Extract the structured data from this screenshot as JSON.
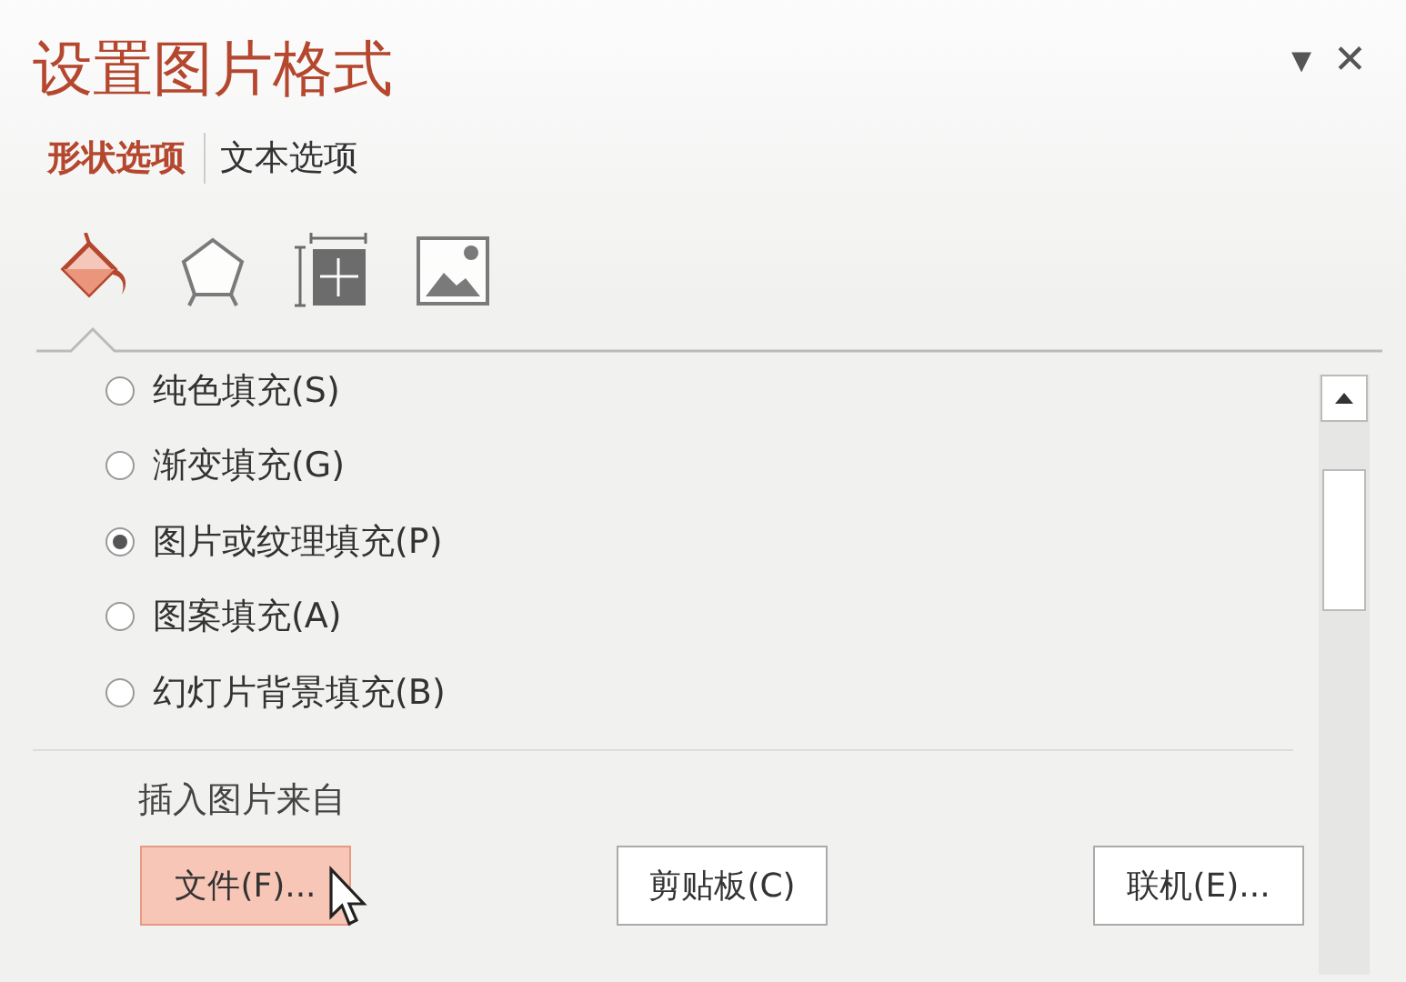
{
  "pane": {
    "title": "设置图片格式",
    "menu_glyph": "▾",
    "close_glyph": "✕"
  },
  "tabs": [
    {
      "label": "形状选项",
      "selected": true
    },
    {
      "label": "文本选项",
      "selected": false
    }
  ],
  "icon_tabs": [
    {
      "selected": true
    },
    {
      "selected": false
    },
    {
      "selected": false
    },
    {
      "selected": false
    }
  ],
  "fill_options": [
    {
      "label": "纯色填充(S)",
      "selected": false
    },
    {
      "label": "渐变填充(G)",
      "selected": false
    },
    {
      "label": "图片或纹理填充(P)",
      "selected": true
    },
    {
      "label": "图案填充(A)",
      "selected": false
    },
    {
      "label": "幻灯片背景填充(B)",
      "selected": false
    }
  ],
  "insert_from": {
    "label": "插入图片来自",
    "buttons": [
      {
        "label": "文件(F)...",
        "hovered": true
      },
      {
        "label": "剪贴板(C)",
        "hovered": false
      },
      {
        "label": "联机(E)...",
        "hovered": false
      }
    ]
  }
}
